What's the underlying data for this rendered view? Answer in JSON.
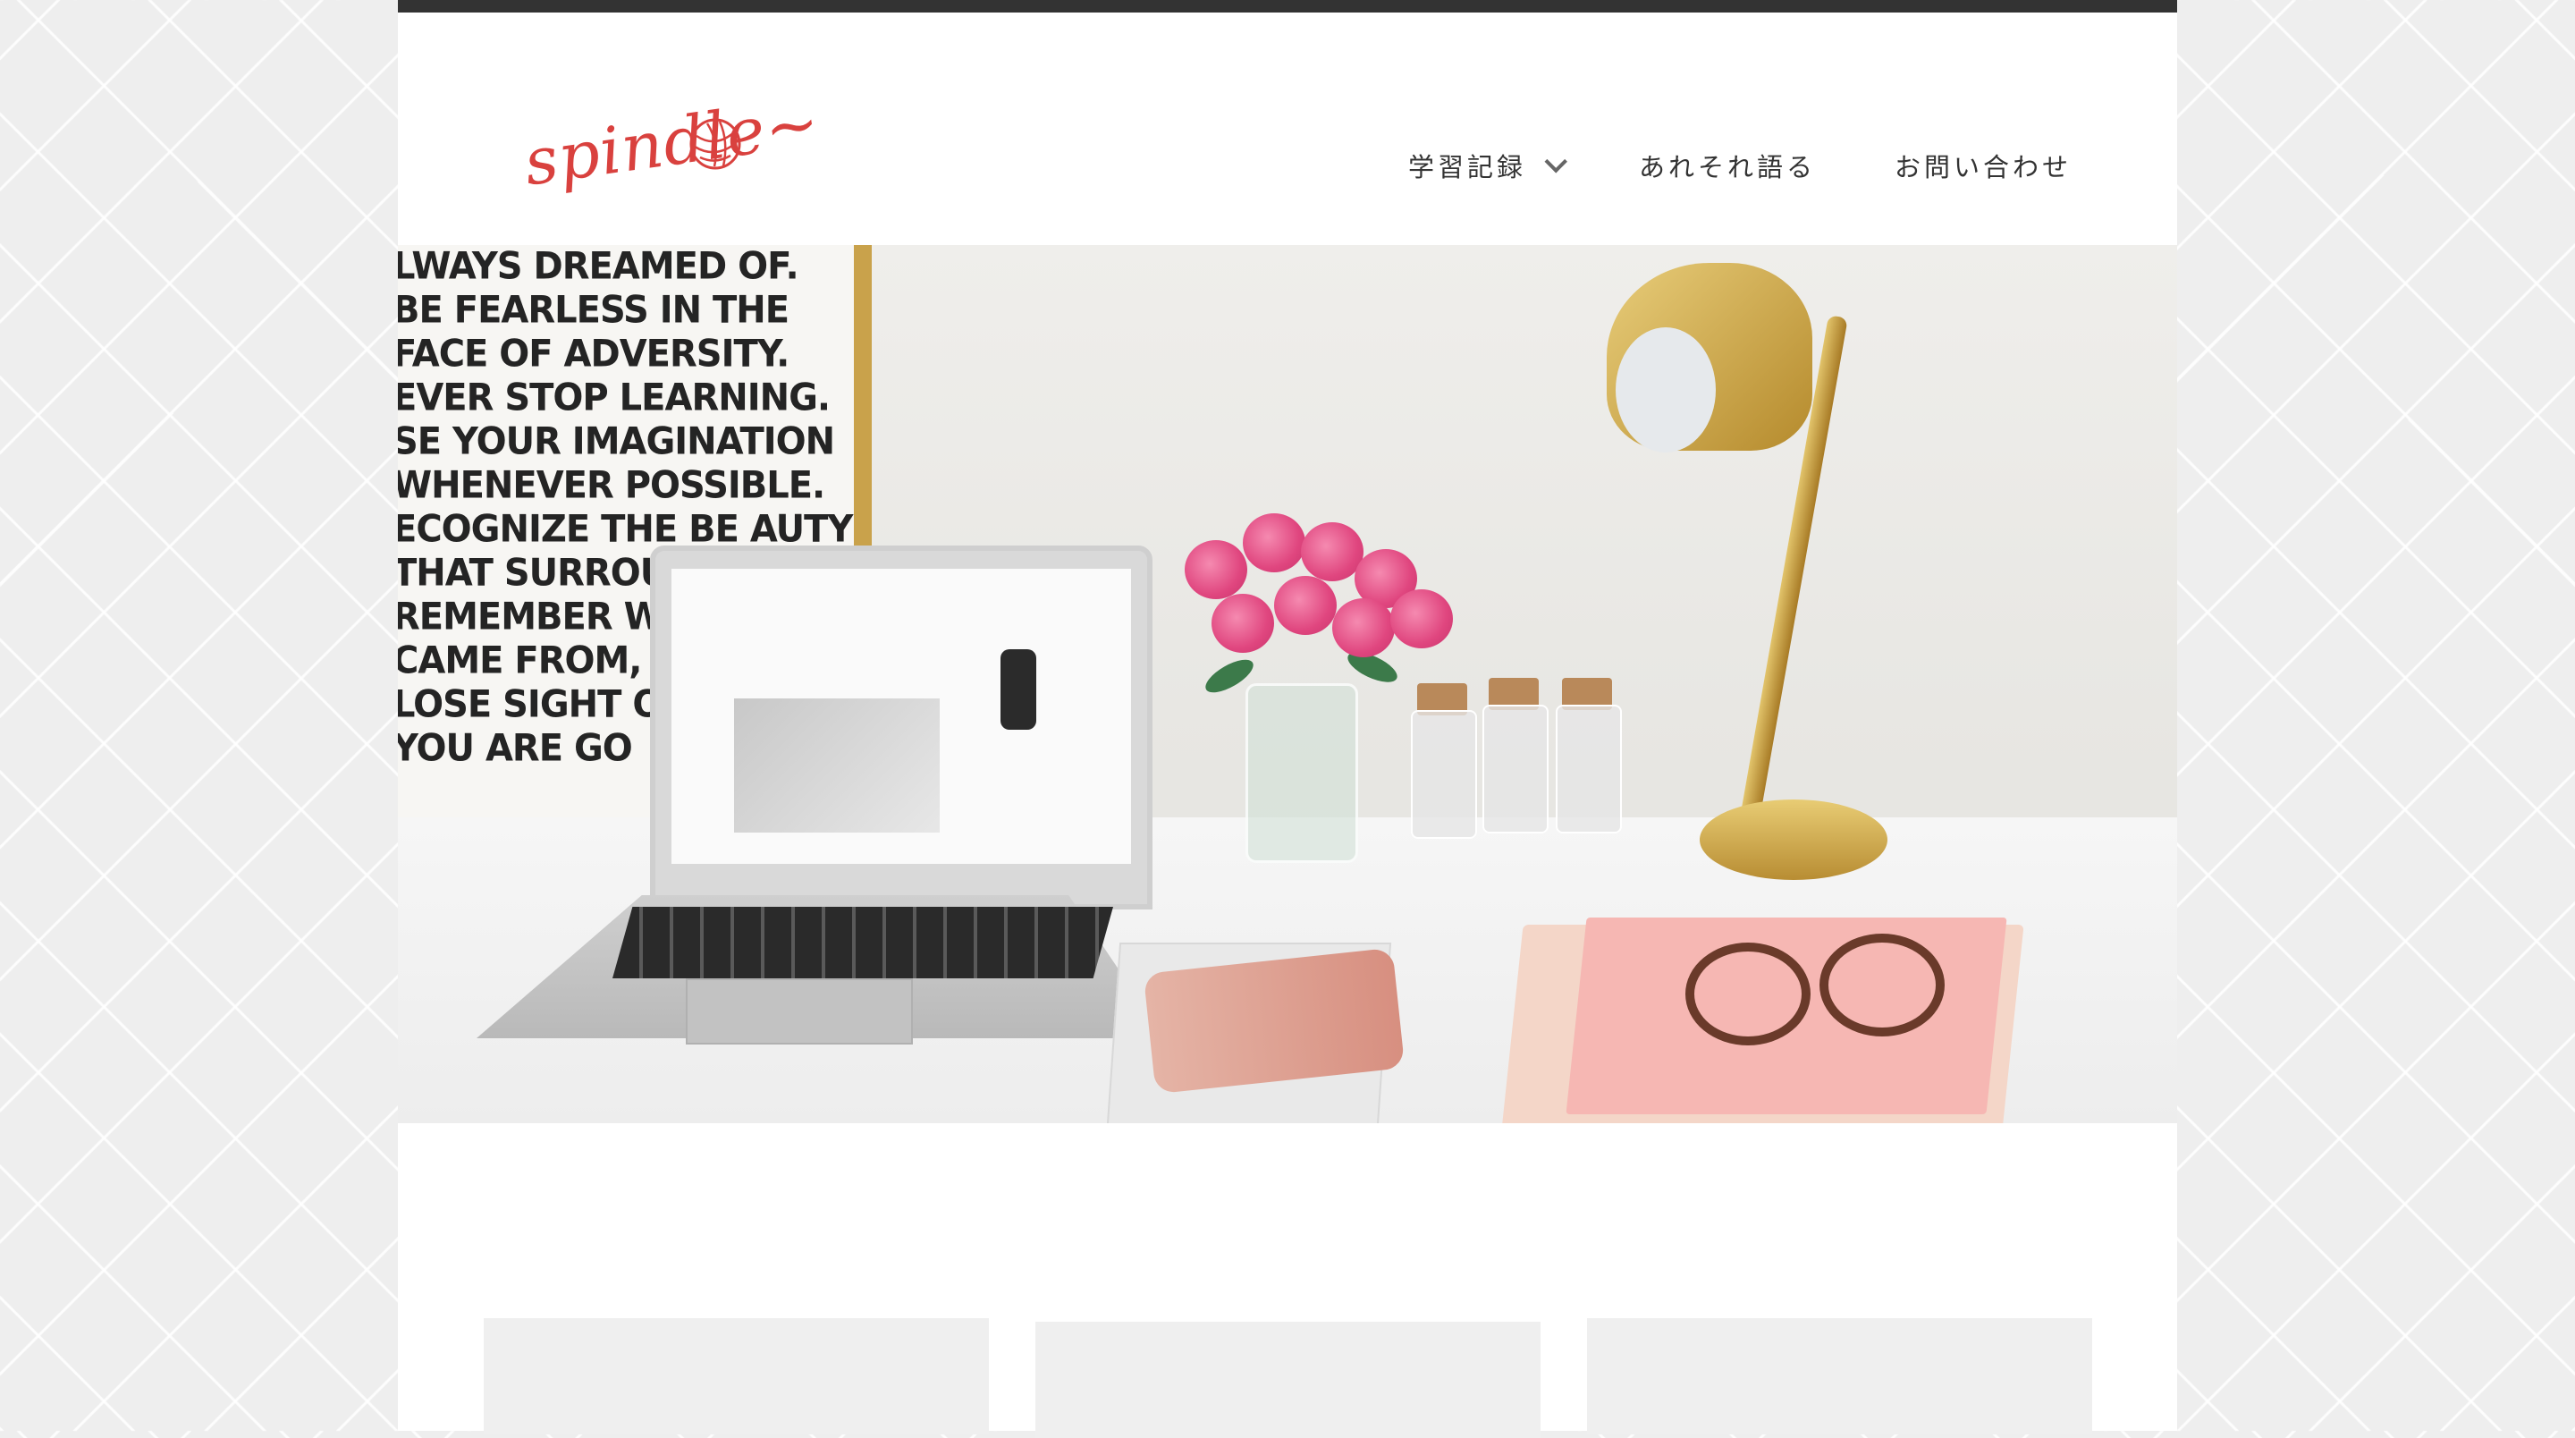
{
  "brand": {
    "logo_text": "spindle~"
  },
  "nav": {
    "items": [
      {
        "label": "学習記録",
        "has_dropdown": true
      },
      {
        "label": "あれそれ語る",
        "has_dropdown": false
      },
      {
        "label": "お問い合わせ",
        "has_dropdown": false
      }
    ]
  },
  "hero": {
    "poster_lines": [
      "LWAYS DREAMED OF.",
      "BE FEARLESS IN THE",
      "FACE OF ADVERSITY.",
      "EVER STOP LEARNING.",
      "SE YOUR IMAGINATION",
      "WHENEVER POSSIBLE.",
      "ECOGNIZE THE BE AUTY",
      "THAT SURROUN",
      "REMEMBER WHI",
      "CAME FROM, BUT",
      "LOSE SIGHT OF",
      "YOU ARE GO"
    ]
  },
  "colors": {
    "topbar": "#333333",
    "logo": "#d9413e",
    "card_bg": "#efefef"
  }
}
